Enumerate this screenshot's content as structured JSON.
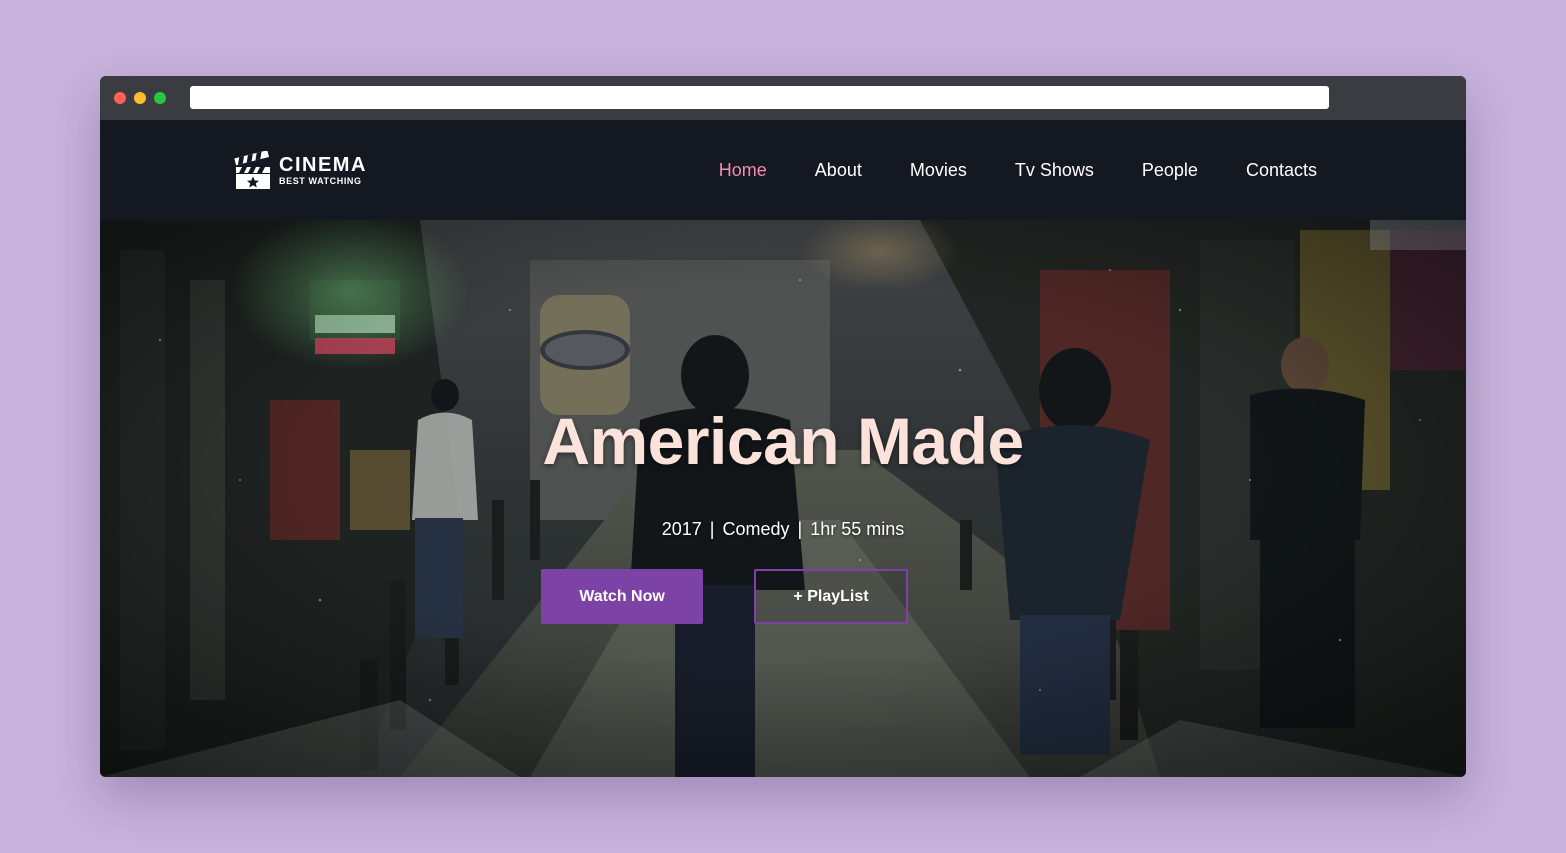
{
  "site": {
    "logo_title": "CINEMA",
    "logo_subtitle": "BEST WATCHING"
  },
  "nav": {
    "items": [
      {
        "label": "Home",
        "active": true
      },
      {
        "label": "About",
        "active": false
      },
      {
        "label": "Movies",
        "active": false
      },
      {
        "label": "Tv Shows",
        "active": false
      },
      {
        "label": "People",
        "active": false
      },
      {
        "label": "Contacts",
        "active": false
      }
    ]
  },
  "hero": {
    "title": "American Made",
    "year": "2017",
    "genre": "Comedy",
    "duration": "1hr 55 mins",
    "separator": "|",
    "watch_label": "Watch Now",
    "playlist_label": "+ PlayList"
  },
  "colors": {
    "page_background": "#c7b3dc",
    "navbar": "#141821",
    "accent": "#7c42a5",
    "active_nav": "#f38bb3",
    "title": "#fbe3dc"
  },
  "icons": {
    "logo": "clapperboard-icon",
    "window_controls": [
      "close-dot",
      "minimize-dot",
      "maximize-dot"
    ]
  }
}
